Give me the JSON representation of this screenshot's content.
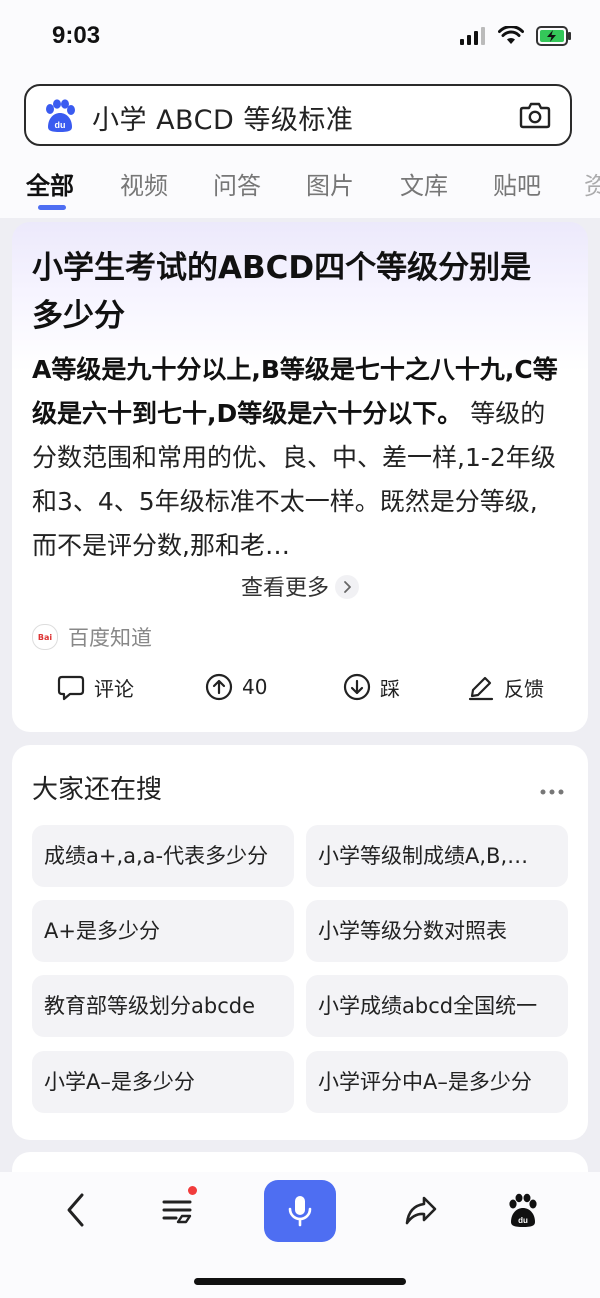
{
  "status_bar": {
    "time": "9:03"
  },
  "search": {
    "query": "小学 ABCD 等级标准",
    "icon": "baidu-paw-icon"
  },
  "tabs": [
    {
      "label": "全部",
      "active": true
    },
    {
      "label": "视频"
    },
    {
      "label": "问答"
    },
    {
      "label": "图片"
    },
    {
      "label": "文库"
    },
    {
      "label": "贴吧"
    },
    {
      "label": "资"
    }
  ],
  "answer": {
    "title": "小学生考试的ABCD四个等级分别是多少分",
    "bold_text": "A等级是九十分以上,B等级是七十之八十九,C等级是六十到七十,D等级是六十分以下。",
    "body_text": " 等级的分数范围和常用的优、良、中、差一样,1-2年级和3、4、5年级标准不太一样。既然是分等级,而不是评分数,那和老…",
    "more_label": "查看更多",
    "source": "百度知道",
    "actions": {
      "comment": "评论",
      "upvote_count": "40",
      "downvote": "踩",
      "feedback": "反馈"
    }
  },
  "related": {
    "title": "大家还在搜",
    "items": [
      "成绩a+,a,a-代表多少分",
      "小学等级制成绩A,B,…",
      "A+是多少分",
      "小学等级分数对照表",
      "教育部等级划分abcde",
      "小学成绩abcd全国统一",
      "小学A–是多少分",
      "小学评分中A–是多少分"
    ]
  },
  "colors": {
    "accent": "#4e6ef2",
    "badge": "#f13c3c"
  }
}
